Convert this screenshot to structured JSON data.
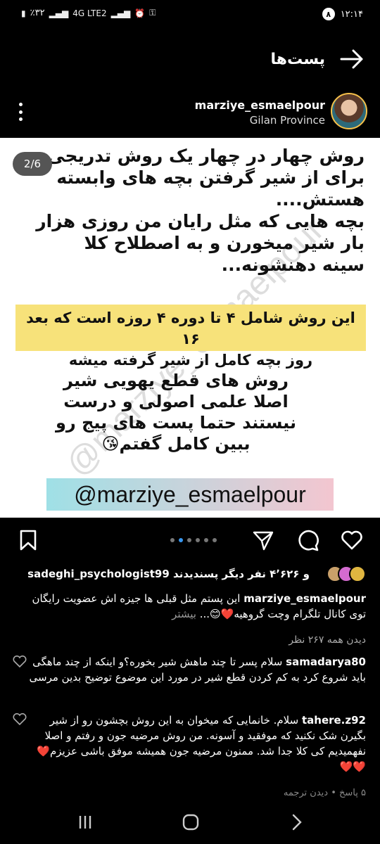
{
  "status_bar": {
    "battery": "٪۳۲",
    "network": "4G LTE2",
    "time": "۱۲:۱۴",
    "notification_count": "۸"
  },
  "header": {
    "title": "پست‌ها"
  },
  "post": {
    "author": "marziye_esmaelpour",
    "location": "Gilan Province",
    "counter": "2/6",
    "watermark": "@marziye_esmaelpour",
    "para1": [
      "روش چهار در چهار یک روش تدریجی",
      "برای از شیر گرفتن بچه های وابسته",
      "هستش....",
      "بچه هایی که مثل رایان من روزی هزار",
      "بار شیر میخورن و به اصطلاح کلا",
      "سینه دهنشونه..."
    ],
    "highlight": [
      "این روش شامل ۴ تا دوره ۴ روزه است که بعد ۱۶",
      "روز بچه کامل از شیر گرفته میشه"
    ],
    "para2": [
      "روش های قطع یهویی شیر",
      "اصلا علمی اصولی و درست",
      "نیستند حتما پست های پیج رو",
      "ببین کامل گفتم😘"
    ],
    "handle": "@marziye_esmaelpour"
  },
  "likes": {
    "text": "و ۴٬۶۲۶ نفر دیگر پسندیدند sadeghi_psychologist99"
  },
  "caption": {
    "user": "marziye_esmaelpour",
    "text": "این پستم مثل قبلی ها جیزه اش عضویت رایگان توی کانال تلگرام وچت گروهیه❤️😊...",
    "more": "بیشتر"
  },
  "views": "دیدن همه ۲۶۷ نظر",
  "comments": [
    {
      "user": "samadarya80",
      "text": "سلام پسر تا چند ماهش شیر بخوره؟و اینکه از چند ماهگی باید شروع کرد به کم کردن قطع شیر در مورد این موضوع توضیح بدین مرسی"
    },
    {
      "user": "tahere.z92",
      "text": "سلام. خانمایی که میخوان به این روش بچشون رو از شیر بگیرن شک نکنید که موفقید و آسونه. من روش مرضیه جون و رفتم و اصلا نفهمیدیم کی کلا جدا شد. ممنون مرضیه جون همیشه موفق باشی عزیزم❤️❤️❤️"
    }
  ],
  "more_comments": "۵ پاسخ • دیدن ترجمه",
  "colors": {
    "accent_blue": "#3897f0",
    "highlight_yellow": "#f7e27a"
  }
}
